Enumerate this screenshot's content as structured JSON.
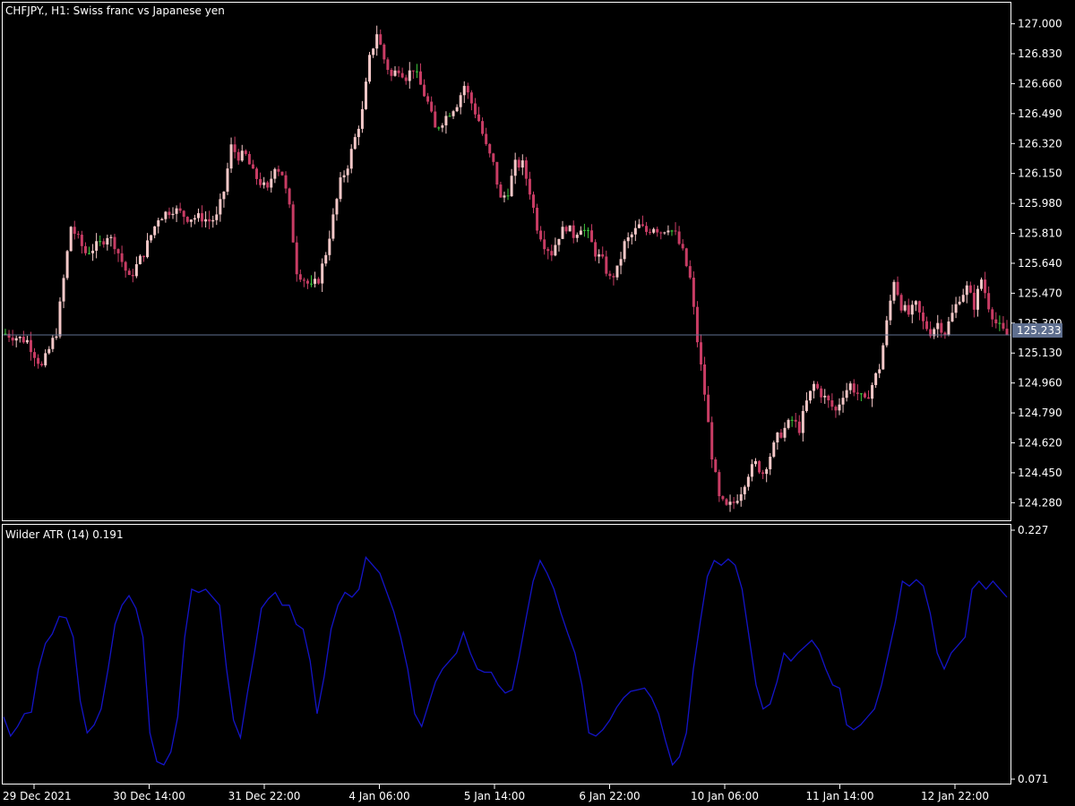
{
  "header": {
    "symbol_label": "CHFJPY., H1:  Swiss franc vs Japanese yen"
  },
  "indicator": {
    "label": "Wilder ATR (14) 0.191"
  },
  "colors": {
    "background": "#000000",
    "frame": "#ffffff",
    "bull_candle": "#f5c8c8",
    "bear_candle": "#c83c64",
    "doji_candle": "#3cc83c",
    "price_line": "#5f6f8f",
    "price_tag_bg": "#5f6f8f",
    "atr_line": "#1414c8"
  },
  "chart_data": [
    {
      "type": "candlestick",
      "title": "CHFJPY., H1:  Swiss franc vs Japanese yen",
      "ylim": [
        124.18,
        127.12
      ],
      "current_price": "125.233",
      "y_ticks": [
        "127.000",
        "126.830",
        "126.660",
        "126.490",
        "126.320",
        "126.150",
        "125.980",
        "125.810",
        "125.640",
        "125.470",
        "125.300",
        "125.130",
        "124.960",
        "124.790",
        "124.620",
        "124.450",
        "124.280"
      ],
      "close_path": [
        [
          0,
          125.24
        ],
        [
          6,
          125.2
        ],
        [
          10,
          125.05
        ],
        [
          14,
          125.25
        ],
        [
          18,
          125.85
        ],
        [
          22,
          125.7
        ],
        [
          26,
          125.75
        ],
        [
          28,
          125.8
        ],
        [
          30,
          125.75
        ],
        [
          34,
          125.55
        ],
        [
          38,
          125.7
        ],
        [
          42,
          125.9
        ],
        [
          46,
          125.95
        ],
        [
          50,
          125.9
        ],
        [
          54,
          125.9
        ],
        [
          56,
          125.88
        ],
        [
          58,
          125.9
        ],
        [
          60,
          126.05
        ],
        [
          62,
          126.3
        ],
        [
          64,
          126.25
        ],
        [
          66,
          126.25
        ],
        [
          68,
          126.15
        ],
        [
          70,
          126.1
        ],
        [
          72,
          126.05
        ],
        [
          74,
          126.2
        ],
        [
          76,
          126.15
        ],
        [
          78,
          125.95
        ],
        [
          80,
          125.6
        ],
        [
          82,
          125.55
        ],
        [
          84,
          125.5
        ],
        [
          86,
          125.55
        ],
        [
          88,
          125.7
        ],
        [
          90,
          125.9
        ],
        [
          92,
          126.1
        ],
        [
          94,
          126.2
        ],
        [
          96,
          126.35
        ],
        [
          98,
          126.5
        ],
        [
          100,
          126.8
        ],
        [
          102,
          126.95
        ],
        [
          104,
          126.8
        ],
        [
          106,
          126.7
        ],
        [
          108,
          126.75
        ],
        [
          110,
          126.7
        ],
        [
          112,
          126.75
        ],
        [
          114,
          126.65
        ],
        [
          116,
          126.55
        ],
        [
          118,
          126.4
        ],
        [
          120,
          126.45
        ],
        [
          122,
          126.5
        ],
        [
          124,
          126.55
        ],
        [
          126,
          126.65
        ],
        [
          128,
          126.55
        ],
        [
          130,
          126.45
        ],
        [
          132,
          126.3
        ],
        [
          134,
          126.2
        ],
        [
          136,
          126.0
        ],
        [
          138,
          126.05
        ],
        [
          140,
          126.2
        ],
        [
          142,
          126.2
        ],
        [
          144,
          126.05
        ],
        [
          146,
          125.85
        ],
        [
          148,
          125.75
        ],
        [
          150,
          125.7
        ],
        [
          152,
          125.8
        ],
        [
          154,
          125.85
        ],
        [
          156,
          125.8
        ],
        [
          158,
          125.85
        ],
        [
          160,
          125.8
        ],
        [
          162,
          125.7
        ],
        [
          164,
          125.65
        ],
        [
          166,
          125.55
        ],
        [
          168,
          125.6
        ],
        [
          170,
          125.75
        ],
        [
          172,
          125.8
        ],
        [
          174,
          125.85
        ],
        [
          176,
          125.82
        ],
        [
          178,
          125.85
        ],
        [
          180,
          125.82
        ],
        [
          182,
          125.85
        ],
        [
          184,
          125.8
        ],
        [
          186,
          125.7
        ],
        [
          188,
          125.55
        ],
        [
          190,
          125.2
        ],
        [
          192,
          124.9
        ],
        [
          194,
          124.55
        ],
        [
          196,
          124.3
        ],
        [
          198,
          124.25
        ],
        [
          200,
          124.28
        ],
        [
          202,
          124.35
        ],
        [
          204,
          124.45
        ],
        [
          206,
          124.5
        ],
        [
          208,
          124.45
        ],
        [
          210,
          124.55
        ],
        [
          212,
          124.65
        ],
        [
          214,
          124.7
        ],
        [
          216,
          124.75
        ],
        [
          218,
          124.7
        ],
        [
          220,
          124.85
        ],
        [
          222,
          124.95
        ],
        [
          224,
          124.9
        ],
        [
          226,
          124.85
        ],
        [
          228,
          124.8
        ],
        [
          230,
          124.9
        ],
        [
          232,
          124.95
        ],
        [
          234,
          124.9
        ],
        [
          236,
          124.85
        ],
        [
          238,
          124.95
        ],
        [
          240,
          125.05
        ],
        [
          242,
          125.3
        ],
        [
          244,
          125.55
        ],
        [
          246,
          125.4
        ],
        [
          248,
          125.35
        ],
        [
          250,
          125.4
        ],
        [
          252,
          125.3
        ],
        [
          254,
          125.25
        ],
        [
          256,
          125.3
        ],
        [
          258,
          125.25
        ],
        [
          260,
          125.35
        ],
        [
          262,
          125.45
        ],
        [
          264,
          125.5
        ],
        [
          266,
          125.4
        ],
        [
          268,
          125.55
        ],
        [
          270,
          125.4
        ],
        [
          272,
          125.3
        ],
        [
          274,
          125.25
        ],
        [
          275,
          125.23
        ]
      ]
    },
    {
      "type": "line",
      "title": "Wilder ATR (14) 0.191",
      "ylim": [
        0.071,
        0.227
      ],
      "y_ticks": [
        "0.227",
        "0.071"
      ],
      "series": [
        {
          "values": [
            [
              0,
              0.11
            ],
            [
              2,
              0.098
            ],
            [
              4,
              0.104
            ],
            [
              6,
              0.112
            ],
            [
              8,
              0.113
            ],
            [
              10,
              0.14
            ],
            [
              12,
              0.156
            ],
            [
              14,
              0.162
            ],
            [
              16,
              0.173
            ],
            [
              18,
              0.172
            ],
            [
              20,
              0.16
            ],
            [
              22,
              0.12
            ],
            [
              24,
              0.1
            ],
            [
              26,
              0.105
            ],
            [
              28,
              0.115
            ],
            [
              30,
              0.14
            ],
            [
              32,
              0.168
            ],
            [
              34,
              0.18
            ],
            [
              36,
              0.186
            ],
            [
              38,
              0.178
            ],
            [
              40,
              0.16
            ],
            [
              42,
              0.1
            ],
            [
              44,
              0.082
            ],
            [
              46,
              0.08
            ],
            [
              48,
              0.088
            ],
            [
              50,
              0.11
            ],
            [
              52,
              0.16
            ],
            [
              54,
              0.19
            ],
            [
              56,
              0.188
            ],
            [
              58,
              0.19
            ],
            [
              60,
              0.185
            ],
            [
              62,
              0.18
            ],
            [
              64,
              0.14
            ],
            [
              66,
              0.108
            ],
            [
              68,
              0.097
            ],
            [
              70,
              0.125
            ],
            [
              72,
              0.15
            ],
            [
              74,
              0.178
            ],
            [
              76,
              0.184
            ],
            [
              78,
              0.188
            ],
            [
              80,
              0.18
            ],
            [
              82,
              0.18
            ],
            [
              84,
              0.168
            ],
            [
              86,
              0.165
            ],
            [
              88,
              0.145
            ],
            [
              90,
              0.112
            ],
            [
              92,
              0.135
            ],
            [
              94,
              0.165
            ],
            [
              96,
              0.18
            ],
            [
              98,
              0.188
            ],
            [
              100,
              0.185
            ],
            [
              102,
              0.19
            ],
            [
              104,
              0.21
            ],
            [
              106,
              0.205
            ],
            [
              108,
              0.2
            ],
            [
              110,
              0.188
            ],
            [
              112,
              0.176
            ],
            [
              114,
              0.16
            ],
            [
              116,
              0.14
            ],
            [
              118,
              0.112
            ],
            [
              120,
              0.104
            ],
            [
              122,
              0.118
            ],
            [
              124,
              0.132
            ],
            [
              126,
              0.14
            ],
            [
              128,
              0.145
            ],
            [
              130,
              0.15
            ],
            [
              132,
              0.163
            ],
            [
              134,
              0.15
            ],
            [
              136,
              0.14
            ],
            [
              138,
              0.138
            ],
            [
              140,
              0.138
            ],
            [
              142,
              0.13
            ],
            [
              144,
              0.125
            ],
            [
              146,
              0.127
            ],
            [
              148,
              0.148
            ],
            [
              150,
              0.172
            ],
            [
              152,
              0.195
            ],
            [
              154,
              0.208
            ],
            [
              156,
              0.2
            ],
            [
              158,
              0.19
            ],
            [
              160,
              0.175
            ],
            [
              162,
              0.162
            ],
            [
              164,
              0.15
            ],
            [
              166,
              0.13
            ],
            [
              168,
              0.1
            ],
            [
              170,
              0.098
            ],
            [
              172,
              0.102
            ],
            [
              174,
              0.108
            ],
            [
              176,
              0.116
            ],
            [
              178,
              0.122
            ],
            [
              180,
              0.126
            ],
            [
              182,
              0.127
            ],
            [
              184,
              0.128
            ],
            [
              186,
              0.122
            ],
            [
              188,
              0.112
            ],
            [
              190,
              0.095
            ],
            [
              192,
              0.08
            ],
            [
              194,
              0.085
            ],
            [
              196,
              0.1
            ],
            [
              198,
              0.14
            ],
            [
              200,
              0.17
            ],
            [
              202,
              0.198
            ],
            [
              204,
              0.208
            ],
            [
              206,
              0.205
            ],
            [
              208,
              0.209
            ],
            [
              210,
              0.205
            ],
            [
              212,
              0.19
            ],
            [
              214,
              0.16
            ],
            [
              216,
              0.13
            ],
            [
              218,
              0.115
            ],
            [
              220,
              0.118
            ],
            [
              222,
              0.132
            ],
            [
              224,
              0.15
            ],
            [
              226,
              0.145
            ],
            [
              228,
              0.15
            ],
            [
              230,
              0.154
            ],
            [
              232,
              0.158
            ],
            [
              234,
              0.152
            ],
            [
              236,
              0.14
            ],
            [
              238,
              0.13
            ],
            [
              240,
              0.128
            ],
            [
              242,
              0.105
            ],
            [
              244,
              0.102
            ],
            [
              246,
              0.105
            ],
            [
              248,
              0.11
            ],
            [
              250,
              0.115
            ],
            [
              252,
              0.13
            ],
            [
              254,
              0.15
            ],
            [
              256,
              0.17
            ],
            [
              258,
              0.195
            ],
            [
              260,
              0.192
            ],
            [
              262,
              0.196
            ],
            [
              264,
              0.192
            ],
            [
              266,
              0.175
            ],
            [
              268,
              0.15
            ],
            [
              270,
              0.14
            ],
            [
              272,
              0.15
            ],
            [
              274,
              0.155
            ],
            [
              276,
              0.16
            ],
            [
              278,
              0.19
            ],
            [
              280,
              0.195
            ],
            [
              282,
              0.19
            ],
            [
              284,
              0.195
            ],
            [
              286,
              0.19
            ],
            [
              288,
              0.185
            ]
          ]
        }
      ]
    }
  ],
  "x_axis": {
    "labels": [
      "29 Dec 2021",
      "30 Dec 14:00",
      "31 Dec 22:00",
      "4 Jan 06:00",
      "5 Jan 14:00",
      "6 Jan 22:00",
      "10 Jan 06:00",
      "11 Jan 14:00",
      "12 Jan 22:00"
    ]
  }
}
